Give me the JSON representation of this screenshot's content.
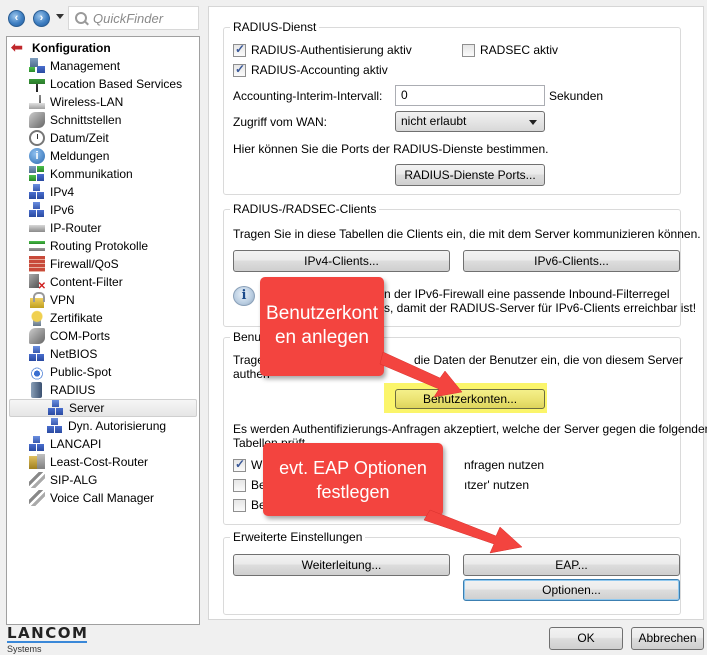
{
  "nav": {
    "back_icon": "arrow-left-icon",
    "forward_icon": "arrow-right-icon",
    "quickfinder_placeholder": "QuickFinder"
  },
  "tree": {
    "root": "Konfiguration",
    "items": [
      {
        "label": "Management",
        "icon": "management-icon"
      },
      {
        "label": "Location Based Services",
        "icon": "signpost-icon"
      },
      {
        "label": "Wireless-LAN",
        "icon": "router-icon"
      },
      {
        "label": "Schnittstellen",
        "icon": "plug-icon"
      },
      {
        "label": "Datum/Zeit",
        "icon": "clock-icon"
      },
      {
        "label": "Meldungen",
        "icon": "info-icon"
      },
      {
        "label": "Kommunikation",
        "icon": "communication-icon"
      },
      {
        "label": "IPv4",
        "icon": "network-icon"
      },
      {
        "label": "IPv6",
        "icon": "network-icon"
      },
      {
        "label": "IP-Router",
        "icon": "ip-router-icon"
      },
      {
        "label": "Routing Protokolle",
        "icon": "routing-icon"
      },
      {
        "label": "Firewall/QoS",
        "icon": "firewall-icon"
      },
      {
        "label": "Content-Filter",
        "icon": "content-filter-icon"
      },
      {
        "label": "VPN",
        "icon": "lock-icon"
      },
      {
        "label": "Zertifikate",
        "icon": "certificate-icon"
      },
      {
        "label": "COM-Ports",
        "icon": "plug-icon"
      },
      {
        "label": "NetBIOS",
        "icon": "network-icon"
      },
      {
        "label": "Public-Spot",
        "icon": "wifi-icon"
      },
      {
        "label": "RADIUS",
        "icon": "server-icon"
      }
    ],
    "radius_children": [
      {
        "label": "Server",
        "icon": "network-icon",
        "selected": true
      },
      {
        "label": "Dyn. Autorisierung",
        "icon": "network-icon",
        "selected": false
      }
    ],
    "items_after": [
      {
        "label": "LANCAPI",
        "icon": "network-icon"
      },
      {
        "label": "Least-Cost-Router",
        "icon": "least-cost-router-icon"
      },
      {
        "label": "SIP-ALG",
        "icon": "phone-icon"
      },
      {
        "label": "Voice Call Manager",
        "icon": "phone-icon"
      }
    ]
  },
  "logo": {
    "name": "LANCOM",
    "sub": "Systems"
  },
  "radius_dienst": {
    "title": "RADIUS-Dienst",
    "auth_label": "RADIUS-Authentisierung aktiv",
    "auth_checked": true,
    "radsec_label": "RADSEC aktiv",
    "radsec_checked": false,
    "accounting_label": "RADIUS-Accounting aktiv",
    "accounting_checked": true,
    "interim_label": "Accounting-Interim-Intervall:",
    "interim_value": "0",
    "interim_unit": "Sekunden",
    "wan_label": "Zugriff vom WAN:",
    "wan_value": "nicht erlaubt",
    "ports_text": "Hier können Sie die Ports der RADIUS-Dienste bestimmen.",
    "ports_button": "RADIUS-Dienste Ports..."
  },
  "clients": {
    "title": "RADIUS-/RADSEC-Clients",
    "text": "Tragen Sie in diese Tabellen die Clients ein, die mit dem Server kommunizieren können.",
    "ipv4_button": "IPv4-Clients...",
    "ipv6_button": "IPv6-Clients...",
    "info_line1": "n der IPv6-Firewall eine passende Inbound-Filterregel",
    "info_line2": "s, damit der RADIUS-Server für IPv6-Clients erreichbar ist!"
  },
  "benutzer": {
    "title": "Benutz",
    "text_line1_a": "Trager",
    "text_line1_b": "die Daten der Benutzer ein, die von diesem Server",
    "text_line2": "authen",
    "accounts_button": "Benutzerkonten...",
    "auth_text_line1": "Es werden Authentifizierungs-Anfragen akzeptiert, welche der Server gegen die folgenden",
    "auth_text_line2": "Tabellen prüft",
    "options": [
      {
        "label_a": "WL",
        "label_b": "nfragen nutzen",
        "checked": true
      },
      {
        "label_a": "Ber",
        "label_b": "ıtzer' nutzen",
        "checked": false
      },
      {
        "label_a": "Ber",
        "label_b": "",
        "checked": false
      }
    ]
  },
  "erweitert": {
    "title": "Erweiterte Einstellungen",
    "forward_button": "Weiterleitung...",
    "eap_button": "EAP...",
    "options_button": "Optionen..."
  },
  "dialog": {
    "ok": "OK",
    "cancel": "Abbrechen"
  },
  "annotations": {
    "callout1_line1": "Benutzerkont",
    "callout1_line2": "en anlegen",
    "callout2_line1": "evt. EAP Optionen",
    "callout2_line2": "festlegen",
    "color": "#f3443f",
    "highlight_color": "#fbf45a"
  }
}
